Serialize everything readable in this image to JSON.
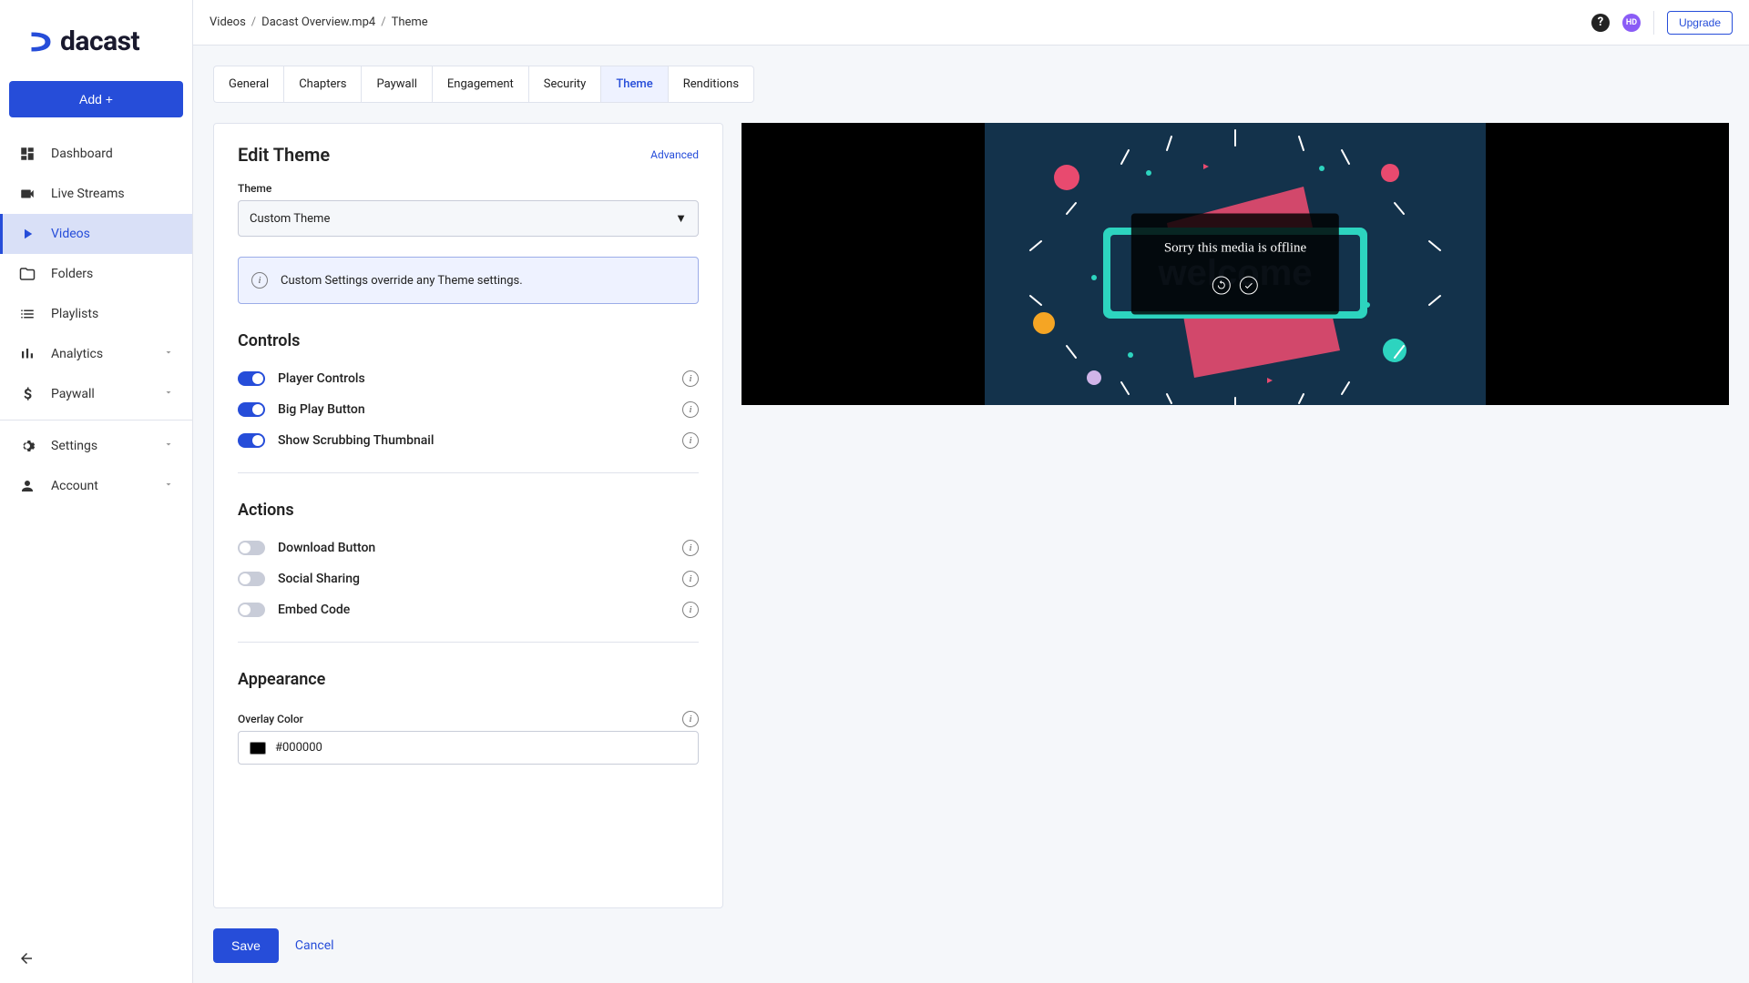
{
  "brand": "dacast",
  "add_button": "Add +",
  "sidebar": {
    "items": [
      {
        "label": "Dashboard",
        "icon": "dashboard-icon",
        "expandable": false
      },
      {
        "label": "Live Streams",
        "icon": "video-cam-icon",
        "expandable": false
      },
      {
        "label": "Videos",
        "icon": "play-icon",
        "expandable": false,
        "active": true
      },
      {
        "label": "Folders",
        "icon": "folder-icon",
        "expandable": false
      },
      {
        "label": "Playlists",
        "icon": "list-icon",
        "expandable": false
      },
      {
        "label": "Analytics",
        "icon": "bars-icon",
        "expandable": true
      },
      {
        "label": "Paywall",
        "icon": "dollar-icon",
        "expandable": true
      },
      {
        "label": "Settings",
        "icon": "gear-icon",
        "expandable": true,
        "divider_before": true
      },
      {
        "label": "Account",
        "icon": "person-icon",
        "expandable": true
      }
    ]
  },
  "breadcrumb": [
    "Videos",
    "Dacast Overview.mp4",
    "Theme"
  ],
  "topbar": {
    "upgrade": "Upgrade",
    "avatar_initials": "HD"
  },
  "tabs": [
    "General",
    "Chapters",
    "Paywall",
    "Engagement",
    "Security",
    "Theme",
    "Renditions"
  ],
  "active_tab": "Theme",
  "panel": {
    "title": "Edit Theme",
    "advanced": "Advanced",
    "theme_label": "Theme",
    "theme_value": "Custom Theme",
    "info": "Custom Settings override any Theme settings.",
    "controls_title": "Controls",
    "controls": [
      {
        "label": "Player Controls",
        "on": true
      },
      {
        "label": "Big Play Button",
        "on": true
      },
      {
        "label": "Show Scrubbing Thumbnail",
        "on": true
      }
    ],
    "actions_title": "Actions",
    "actions": [
      {
        "label": "Download Button",
        "on": false
      },
      {
        "label": "Social Sharing",
        "on": false
      },
      {
        "label": "Embed Code",
        "on": false
      }
    ],
    "appearance_title": "Appearance",
    "overlay_label": "Overlay Color",
    "overlay_value": "#000000"
  },
  "buttons": {
    "save": "Save",
    "cancel": "Cancel"
  },
  "player": {
    "offline": "Sorry this media is offline"
  }
}
